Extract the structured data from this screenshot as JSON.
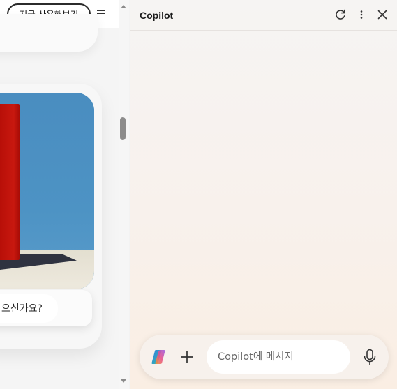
{
  "page": {
    "try_now_label": "지금 사용해보기",
    "question_text": "으신가요?"
  },
  "copilot": {
    "title": "Copilot",
    "input_placeholder": "Copilot에 메시지",
    "icons": {
      "refresh": "refresh-icon",
      "more": "more-vertical-icon",
      "close": "close-icon",
      "logo": "copilot-logo-icon",
      "add": "plus-icon",
      "mic": "microphone-icon"
    }
  },
  "colors": {
    "artwork_sky": "#4a8dc0",
    "artwork_red": "#c8180f",
    "copilot_bg_bottom": "#faeee3"
  }
}
